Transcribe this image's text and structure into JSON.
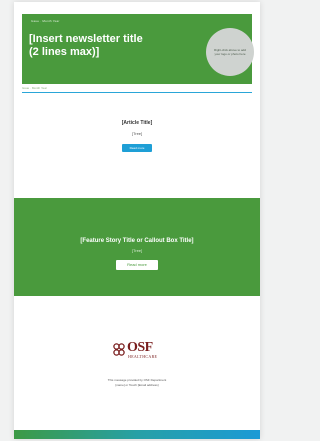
{
  "header": {
    "top_small": "Issue · Month Year",
    "title_line1": "[Insert newsletter title",
    "title_line2": "(2 lines max)]",
    "circle_text": "Right-click above to add your logo or photo here",
    "subline": "Issue · Month Year",
    "bg_color": "#4a9a3d",
    "rule_color": "#2aa6d8"
  },
  "article": {
    "title": "[Article Title]",
    "tag": "[Tree]",
    "button_label": "Read more",
    "button_color": "#1e9fd6"
  },
  "feature": {
    "title": "[Feature Story Title or Callout Box Title]",
    "tag": "[Tree]",
    "button_label": "Read more",
    "bg_color": "#4a9a3d"
  },
  "logo": {
    "wordmark": "OSF",
    "sub": "HEALTHCARE",
    "color": "#7a1f1f"
  },
  "footer": {
    "line1": "This message provided by OSF Department",
    "line2": "[name] or Touch [Email address]"
  }
}
